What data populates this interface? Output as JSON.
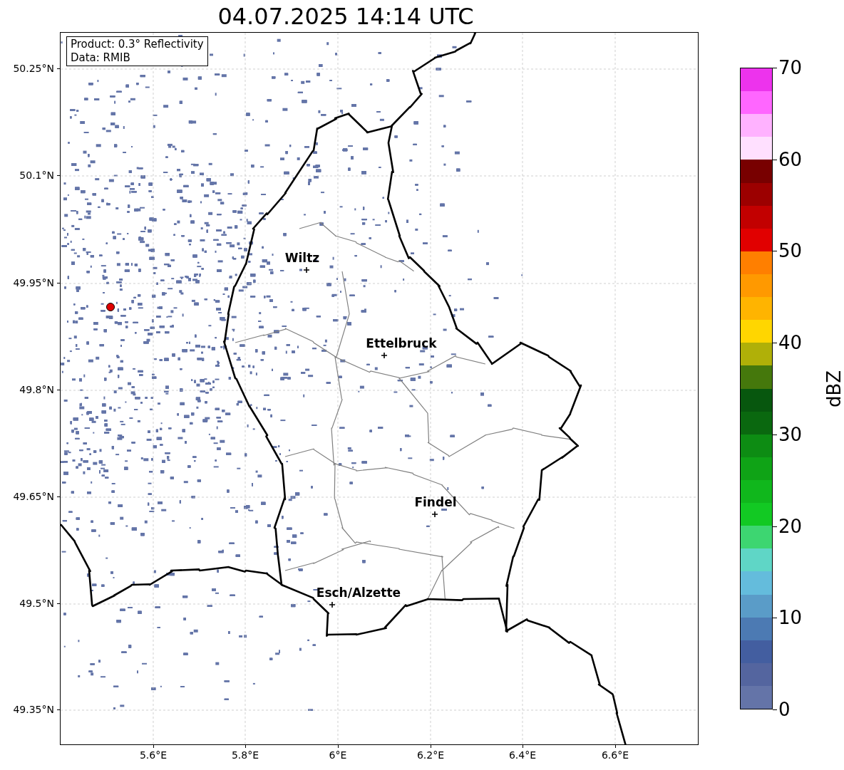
{
  "title": "04.07.2025 14:14 UTC",
  "info_box": [
    "Product: 0.3° Reflectivity",
    "Data: RMIB"
  ],
  "places": [
    {
      "name": "Wiltz"
    },
    {
      "name": "Ettelbruck"
    },
    {
      "name": "Findel"
    },
    {
      "name": "Esch/Alzette"
    }
  ],
  "y_ticks": [
    "50.25°N",
    "50.1°N",
    "49.95°N",
    "49.8°N",
    "49.65°N",
    "49.5°N",
    "49.35°N"
  ],
  "x_ticks": [
    "5.6°E",
    "5.8°E",
    "6°E",
    "6.2°E",
    "6.4°E",
    "6.6°E"
  ],
  "colorbar": {
    "label": "dBZ",
    "ticks": [
      "70",
      "60",
      "50",
      "40",
      "30",
      "20",
      "10",
      "0"
    ],
    "segments": [
      {
        "color": "#ed33ed"
      },
      {
        "color": "#ff66ff"
      },
      {
        "color": "#ffb2ff"
      },
      {
        "color": "#ffe0ff"
      },
      {
        "color": "#780000"
      },
      {
        "color": "#9c0000"
      },
      {
        "color": "#c20000"
      },
      {
        "color": "#e10000"
      },
      {
        "color": "#ff7f00"
      },
      {
        "color": "#ff9900"
      },
      {
        "color": "#ffb400"
      },
      {
        "color": "#ffd600"
      },
      {
        "color": "#b0b008"
      },
      {
        "color": "#45780c"
      },
      {
        "color": "#07570e"
      },
      {
        "color": "#0a680f"
      },
      {
        "color": "#0d8c13"
      },
      {
        "color": "#0fa316"
      },
      {
        "color": "#10b71c"
      },
      {
        "color": "#12c923"
      },
      {
        "color": "#3dd671"
      },
      {
        "color": "#5fd6c6"
      },
      {
        "color": "#64bcdc"
      },
      {
        "color": "#5a9cc8"
      },
      {
        "color": "#4c7ab3"
      },
      {
        "color": "#435ea0"
      },
      {
        "color": "#54659f"
      },
      {
        "color": "#6474a8"
      }
    ]
  }
}
